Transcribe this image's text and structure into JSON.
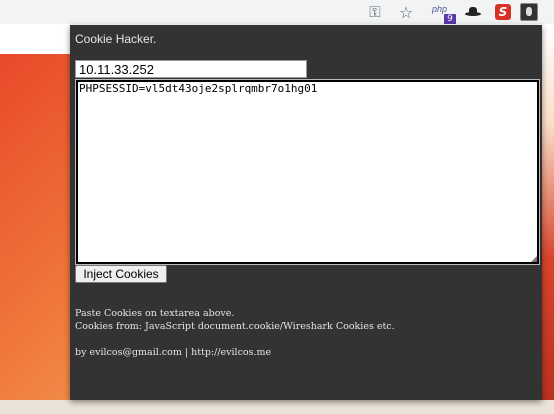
{
  "toolbar": {
    "icons": [
      "key-icon",
      "star-icon",
      "php-extension-icon",
      "hat-extension-icon",
      "s-extension-icon",
      "profile-avatar"
    ],
    "php_text": "php",
    "php_badge": "9",
    "s_text": "S"
  },
  "popup": {
    "title": "Cookie Hacker.",
    "host_value": "10.11.33.252",
    "cookie_value": "PHPSESSID=vl5dt43oje2splrqmbr7o1hg01",
    "inject_label": "Inject Cookies",
    "help_line1": "Paste Cookies on textarea above.",
    "help_line2": "Cookies from: JavaScript document.cookie/Wireshark Cookies etc.",
    "credit": "by evilcos@gmail.com | http://evilcos.me"
  },
  "colors": {
    "popup_bg": "#333333",
    "popup_text": "#e6e6e6",
    "page_accent": "#e8492a"
  }
}
